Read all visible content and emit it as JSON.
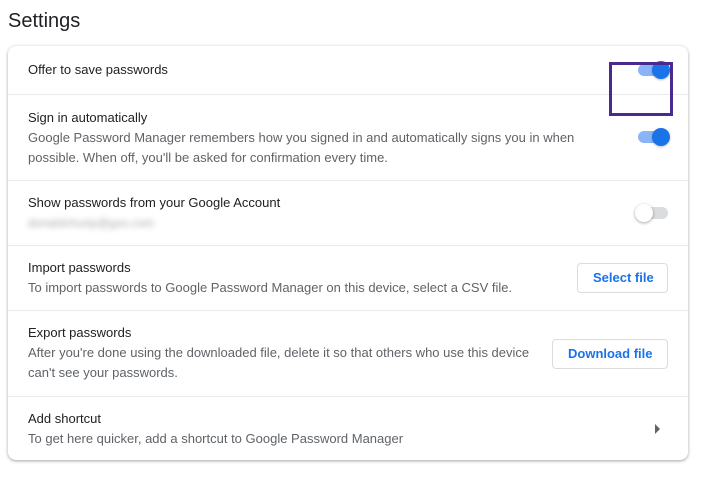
{
  "page": {
    "title": "Settings"
  },
  "rows": {
    "offer_save": {
      "title": "Offer to save passwords",
      "toggle_on": true
    },
    "sign_in_auto": {
      "title": "Sign in automatically",
      "description": "Google Password Manager remembers how you signed in and automatically signs you in when possible. When off, you'll be asked for confirmation every time.",
      "toggle_on": true
    },
    "show_passwords": {
      "title": "Show passwords from your Google Account",
      "account_email": "donaldchurip@gxo.com",
      "toggle_on": false
    },
    "import": {
      "title": "Import passwords",
      "description": "To import passwords to Google Password Manager on this device, select a CSV file.",
      "button_label": "Select file"
    },
    "export": {
      "title": "Export passwords",
      "description": "After you're done using the downloaded file, delete it so that others who use this device can't see your passwords.",
      "button_label": "Download file"
    },
    "shortcut": {
      "title": "Add shortcut",
      "description": "To get here quicker, add a shortcut to Google Password Manager",
      "icon": "chevron-right-icon"
    }
  },
  "colors": {
    "accent": "#1a73e8",
    "highlight": "#4b2a8f"
  }
}
